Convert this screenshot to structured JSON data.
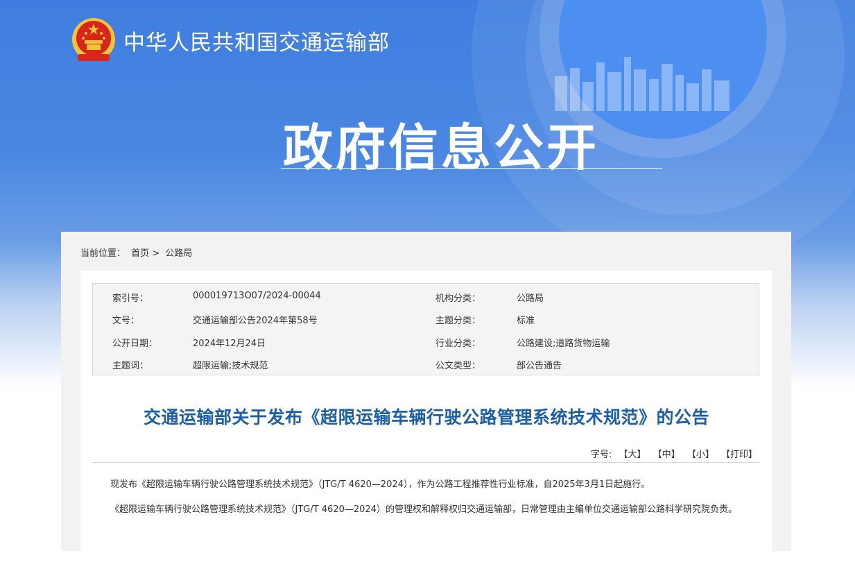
{
  "header": {
    "site_name": "中华人民共和国交通运输部",
    "page_title": "政府信息公开"
  },
  "breadcrumb": {
    "prefix": "当前位置：",
    "home": "首页",
    "separator": ">",
    "current": "公路局"
  },
  "meta": {
    "index_label": "索引号：",
    "index_value": "000019713O07/2024-00044",
    "org_label": "机构分类：",
    "org_value": "公路局",
    "doc_no_label": "文号：",
    "doc_no_value": "交通运输部公告2024年第58号",
    "theme_label": "主题分类：",
    "theme_value": "标准",
    "date_label": "公开日期：",
    "date_value": "2024年12月24日",
    "industry_label": "行业分类：",
    "industry_value": "公路建设;道路货物运输",
    "keywords_label": "主题词：",
    "keywords_value": "超限运输;技术规范",
    "doctype_label": "公文类型：",
    "doctype_value": "部公告通告"
  },
  "article": {
    "title": "交通运输部关于发布《超限运输车辆行驶公路管理系统技术规范》的公告",
    "font_size_label": "字号:",
    "font_large": "【大】",
    "font_medium": "【中】",
    "font_small": "【小】",
    "print": "【打印】",
    "paragraph_1": "现发布《超限运输车辆行驶公路管理系统技术规范》（JTG/T 4620—2024），作为公路工程推荐性行业标准，自2025年3月1日起施行。",
    "paragraph_2": "《超限运输车辆行驶公路管理系统技术规范》（JTG/T 4620—2024）的管理权和解释权归交通运输部，日常管理由主编单位交通运输部公路科学研究院负责。"
  },
  "colors": {
    "banner_blue": "#3f7ee0",
    "title_blue": "#1c5fa8",
    "emblem_red": "#d8261c",
    "emblem_gold": "#f3c33a"
  }
}
